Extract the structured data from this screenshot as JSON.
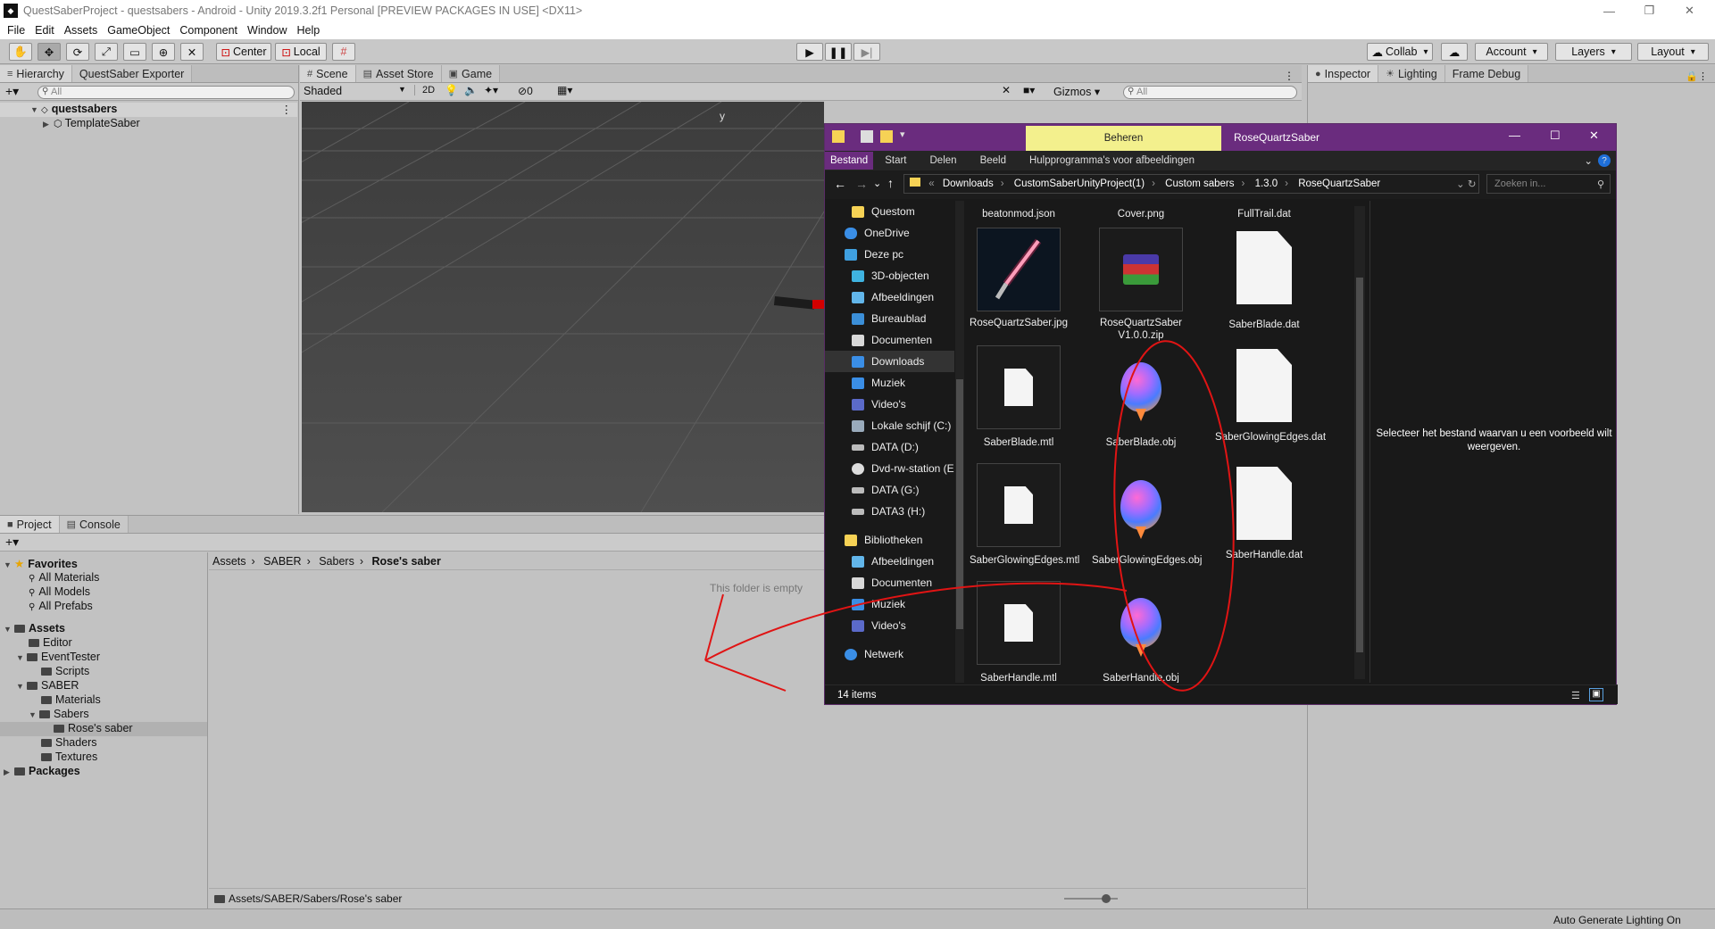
{
  "window": {
    "title": "QuestSaberProject - questsabers - Android - Unity 2019.3.2f1 Personal [PREVIEW PACKAGES IN USE] <DX11>"
  },
  "menu": [
    "File",
    "Edit",
    "Assets",
    "GameObject",
    "Component",
    "Window",
    "Help"
  ],
  "toolbar": {
    "center": "Center",
    "local": "Local",
    "collab": "Collab",
    "account": "Account",
    "layers": "Layers",
    "layout": "Layout"
  },
  "hierarchy": {
    "tab": "Hierarchy",
    "tab2": "QuestSaber Exporter",
    "search_placeholder": "All",
    "scene": "questsabers",
    "child": "TemplateSaber"
  },
  "scene": {
    "tabs": [
      "Scene",
      "Asset Store",
      "Game"
    ],
    "shading": "Shaded",
    "mode2d": "2D",
    "count": "0",
    "gizmos": "Gizmos",
    "search_placeholder": "All",
    "axis": "y"
  },
  "inspector": {
    "tabs": [
      "Inspector",
      "Lighting",
      "Frame Debug"
    ]
  },
  "project": {
    "tabs": [
      "Project",
      "Console"
    ],
    "favorites": "Favorites",
    "fav_items": [
      "All Materials",
      "All Models",
      "All Prefabs"
    ],
    "assets": "Assets",
    "tree": [
      "Editor",
      "EventTester",
      "Scripts",
      "SABER",
      "Materials",
      "Sabers",
      "Rose's saber",
      "Shaders",
      "Textures"
    ],
    "packages": "Packages",
    "breadcrumb": [
      "Assets",
      "SABER",
      "Sabers",
      "Rose's saber"
    ],
    "empty_msg": "This folder is empty",
    "path": "Assets/SABER/Sabers/Rose's saber"
  },
  "statusbar": {
    "text": "Auto Generate Lighting On"
  },
  "explorer": {
    "manage_tab": "Beheren",
    "title": "RoseQuartzSaber",
    "ribbon": [
      "Bestand",
      "Start",
      "Delen",
      "Beeld",
      "Hulpprogramma's voor afbeeldingen"
    ],
    "address": [
      "Downloads",
      "CustomSaberUnityProject(1)",
      "Custom sabers",
      "1.3.0",
      "RoseQuartzSaber"
    ],
    "search_placeholder": "Zoeken in...",
    "nav": [
      "Questom",
      "OneDrive",
      "Deze pc",
      "3D-objecten",
      "Afbeeldingen",
      "Bureaublad",
      "Documenten",
      "Downloads",
      "Muziek",
      "Video's",
      "Lokale schijf (C:)",
      "DATA (D:)",
      "Dvd-rw-station (E",
      "DATA (G:)",
      "DATA3 (H:)",
      "Bibliotheken",
      "Afbeeldingen",
      "Documenten",
      "Muziek",
      "Video's",
      "Netwerk"
    ],
    "files": [
      "beatonmod.json",
      "Cover.png",
      "FullTrail.dat",
      "RoseQuartzSaber.jpg",
      "RoseQuartzSaber V1.0.0.zip",
      "SaberBlade.dat",
      "SaberBlade.mtl",
      "SaberBlade.obj",
      "SaberGlowingEdges.dat",
      "SaberGlowingEdges.mtl",
      "SaberGlowingEdges.obj",
      "SaberHandle.dat",
      "SaberHandle.mtl",
      "SaberHandle.obj"
    ],
    "preview_msg": "Selecteer het bestand waarvan u een voorbeeld wilt weergeven.",
    "item_count": "14 items"
  }
}
